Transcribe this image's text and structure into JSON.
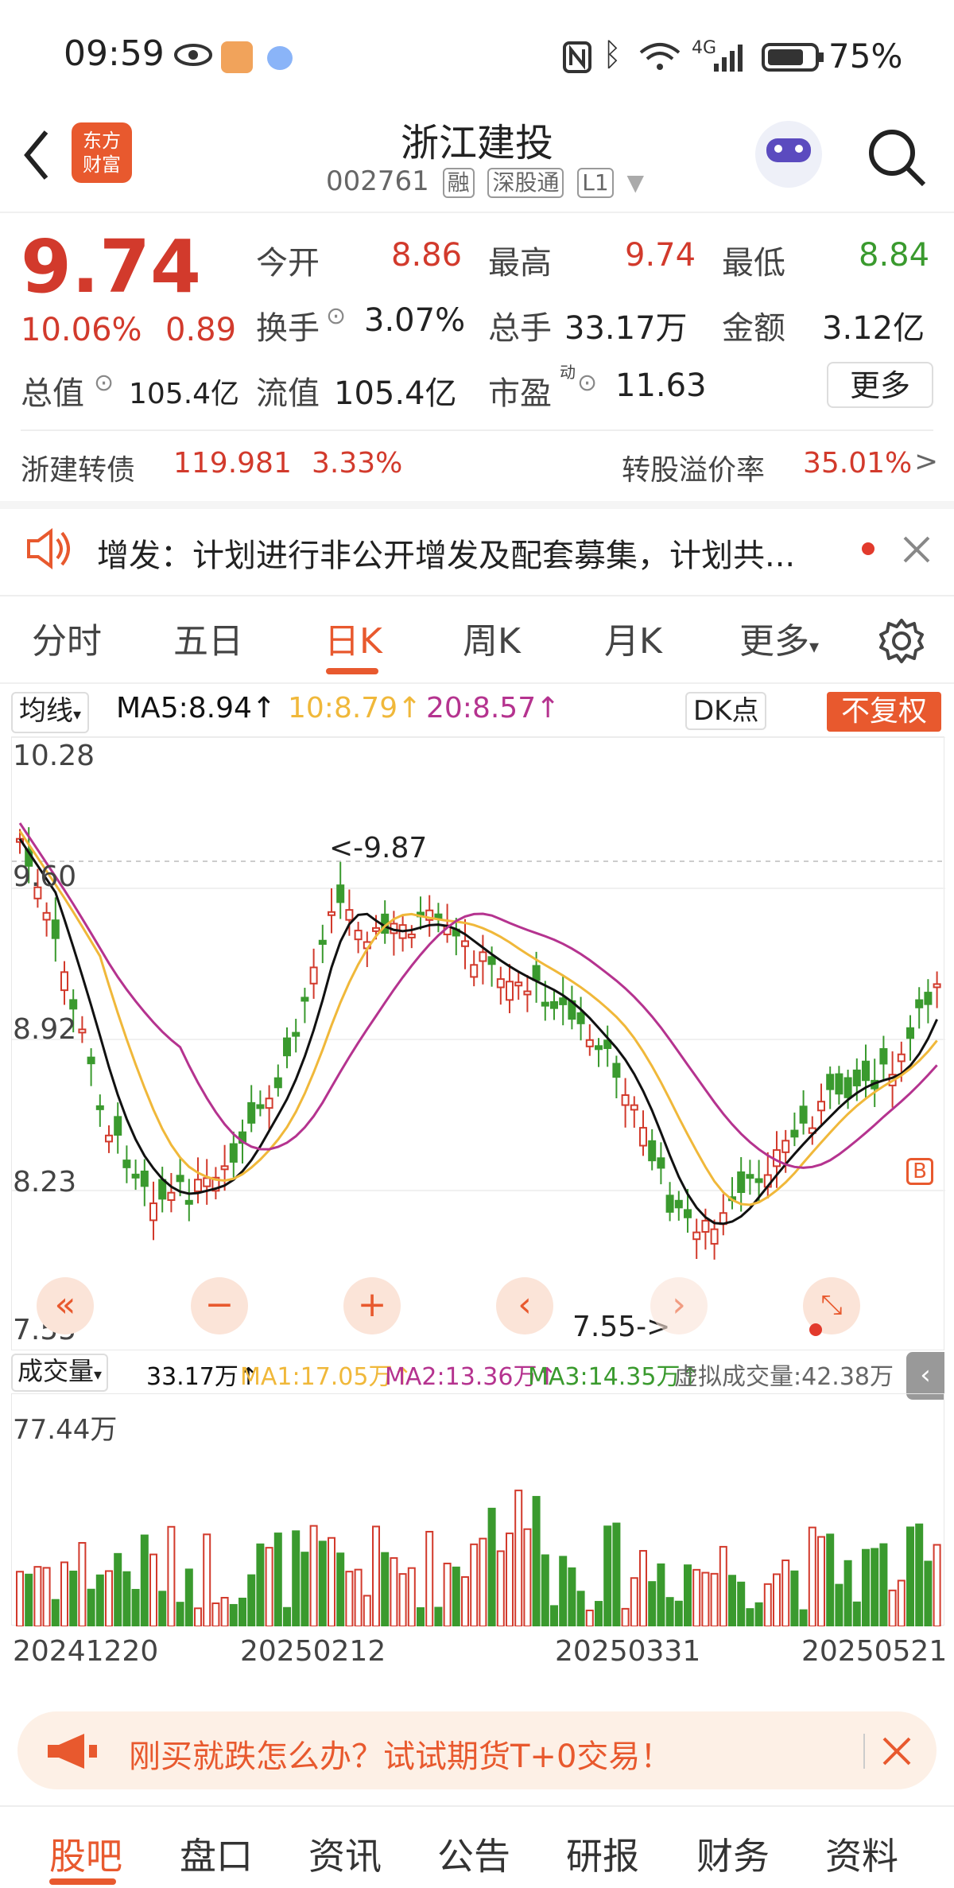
{
  "status_bar": {
    "time": "09:59",
    "battery": "75%",
    "network": "4G"
  },
  "header": {
    "name": "浙江建投",
    "code": "002761",
    "tags": [
      "融",
      "深股通",
      "L1"
    ],
    "logo_text": [
      "东方",
      "财富"
    ]
  },
  "quote": {
    "price": "9.74",
    "change_pct": "10.06%",
    "change": "0.89",
    "open_label": "今开",
    "open": "8.86",
    "high_label": "最高",
    "high": "9.74",
    "low_label": "最低",
    "low": "8.84",
    "turnover_label": "换手",
    "turnover": "3.07%",
    "volume_label": "总手",
    "volume": "33.17万",
    "amount_label": "金额",
    "amount": "3.12亿",
    "mktcap_label": "总值",
    "mktcap": "105.4亿",
    "float_label": "流值",
    "float": "105.4亿",
    "pe_label": "市盈",
    "pe_sup": "动",
    "pe": "11.63",
    "more": "更多"
  },
  "bond": {
    "name": "浙建转债",
    "price": "119.981",
    "pct": "3.33%",
    "premium_label": "转股溢价率",
    "premium": "35.01%"
  },
  "notice": {
    "text": "增发：计划进行非公开增发及配套募集，计划共..."
  },
  "tabs": [
    "分时",
    "五日",
    "日K",
    "周K",
    "月K",
    "更多"
  ],
  "chart": {
    "ma_selector": "均线",
    "ma5": "MA5:8.94↑",
    "ma10": "10:8.79↑",
    "ma20": "20:8.57↑",
    "dk_btn": "DK点",
    "adj_btn": "不复权",
    "y_labels": [
      "10.28",
      "9.60",
      "8.92",
      "8.23",
      "7.55"
    ],
    "high_mark": "<-9.87",
    "low_mark": "7.55->",
    "b_mark": "B"
  },
  "volume": {
    "selector": "成交量",
    "vol": "33.17万↑",
    "ma1": "MA1:17.05万↑",
    "ma2": "MA2:13.36万↑",
    "ma3": "MA3:14.35万↑",
    "virtual": "虚拟成交量:42.38万",
    "max_label": "77.44万"
  },
  "dates": [
    "20241220",
    "20250212",
    "20250331",
    "20250521"
  ],
  "promo": {
    "text": "刚买就跌怎么办？试试期货T+0交易！"
  },
  "bottom_nav": [
    "股吧",
    "盘口",
    "资讯",
    "公告",
    "研报",
    "财务",
    "资料"
  ],
  "colors": {
    "up": "#d23a2c",
    "down": "#3a9a2e",
    "accent": "#e8592e",
    "ma5": "#111111",
    "ma10": "#f0b83a",
    "ma20": "#b5338f"
  }
}
